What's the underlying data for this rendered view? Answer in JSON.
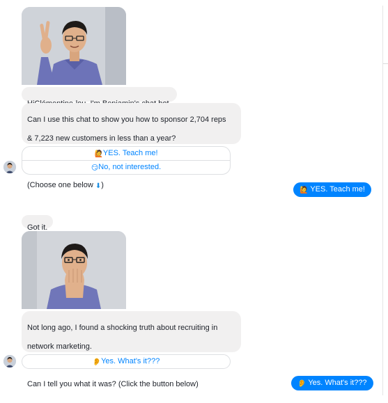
{
  "conversation": {
    "first_block": {
      "greeting": "HiClémentine-lou, I'm Benjamin's chat bot.",
      "greeting_emoji": "👋",
      "question_line1": "Can I use this chat to show you how to sponsor 2,704 reps",
      "question_line2": "& 7,223 new customers in less than a year?",
      "choose_prefix": "(Choose one below ",
      "choose_emoji": "⬇",
      "choose_suffix": ")",
      "quick_replies": [
        {
          "emoji": "🙋",
          "label": "YES. Teach me!"
        },
        {
          "emoji": "😏",
          "label": "No, not interested."
        }
      ]
    },
    "user_reply_1": {
      "emoji": "🙋",
      "label": "YES. Teach me!"
    },
    "second_block": {
      "got_it": "Got it.",
      "story_line1": "Not long ago, I found a shocking truth about recruiting in",
      "story_line2": "network marketing.",
      "story_line3": "Can I tell you what it was? (Click the button below)",
      "quick_replies": [
        {
          "emoji": "👂",
          "label": "Yes. What's it???"
        }
      ]
    },
    "user_reply_2": {
      "emoji": "👂",
      "label": "Yes. What's it???"
    }
  },
  "colors": {
    "bot_bubble": "#f1f0f0",
    "user_bubble": "#0084ff",
    "quick_reply_text": "#0084ff",
    "quick_reply_border": "#dddfe2"
  }
}
